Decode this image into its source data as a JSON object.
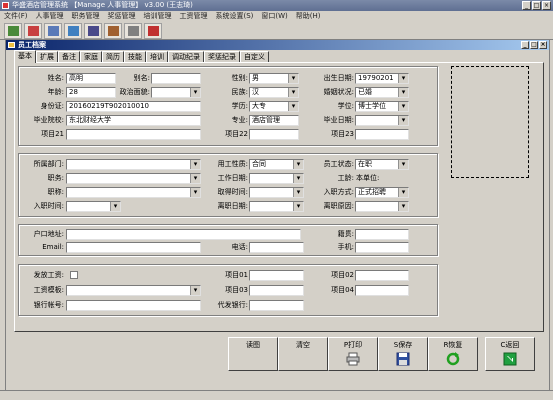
{
  "app": {
    "title": "华盛酒店管理系统 【Manage 人事管理】 v3.00 (王志琦)",
    "window_buttons": [
      "_",
      "□",
      "×"
    ]
  },
  "menu": [
    "文件(F)",
    "人事管理",
    "职务管理",
    "奖惩管理",
    "培训管理",
    "工资管理",
    "系统设置(S)",
    "窗口(W)",
    "帮助(H)"
  ],
  "child": {
    "title": "员工档案",
    "buttons": [
      "_",
      "□",
      "×"
    ]
  },
  "tabs": [
    "基本",
    "扩展",
    "备注",
    "家庭",
    "简历",
    "技能",
    "培训",
    "调动纪录",
    "奖惩纪录",
    "自定义"
  ],
  "basic": {
    "name_label": "姓名:",
    "name_value": "高明",
    "alias_label": "别名:",
    "alias_value": "",
    "gender_label": "性别:",
    "gender_value": "男",
    "birth_label": "出生日期:",
    "birth_value": "19790201",
    "age_label": "年龄:",
    "age_value": "28",
    "political_label": "政治面貌:",
    "political_value": "",
    "ethnic_label": "民族:",
    "ethnic_value": "汉",
    "marital_label": "婚姻状况:",
    "marital_value": "已婚",
    "id_label": "身份证:",
    "id_value": "20160219T902010010",
    "education_label": "学历:",
    "education_value": "大专",
    "degree_label": "学位:",
    "degree_value": "博士学位",
    "school_label": "毕业院校:",
    "school_value": "东北财经大学",
    "major_label": "专业:",
    "major_value": "酒店管理",
    "graddate_label": "毕业日期:",
    "graddate_value": "",
    "item21_label": "项目21",
    "item21_value": "",
    "item22_label": "项目22",
    "item22_value": "",
    "item23_label": "项目23",
    "item23_value": ""
  },
  "job": {
    "dept_label": "所属部门:",
    "dept_value": "",
    "emptype_label": "用工性质:",
    "emptype_value": "合同",
    "status_label": "员工状态:",
    "status_value": "在职",
    "position_label": "职务:",
    "position_value": "",
    "workdate_label": "工作日期:",
    "workdate_value": "",
    "seniority_label": "工龄:",
    "seniority_value": "本单位:",
    "title_label": "职称:",
    "title_value": "",
    "titledate_label": "取得时间:",
    "titledate_value": "",
    "entrymode_label": "入职方式:",
    "entrymode_value": "正式招聘",
    "entrydate_label": "入职时间:",
    "entrydate_value": "",
    "leavedate_label": "离职日期:",
    "leavedate_value": "",
    "leavereason_label": "离职原因:",
    "leavereason_value": ""
  },
  "contact": {
    "hukou_label": "户口地址:",
    "hukou_value": "",
    "native_label": "籍贯:",
    "native_value": "",
    "email_label": "Email:",
    "email_value": "",
    "phone_label": "电话:",
    "phone_value": "",
    "mobile_label": "手机:",
    "mobile_value": ""
  },
  "salary": {
    "paysalary_label": "发放工资:",
    "template_label": "工资模板:",
    "template_value": "",
    "bankacct_label": "银行帐号:",
    "bankacct_value": "",
    "item01_label": "项目01",
    "item01_value": "",
    "item02_label": "项目02",
    "item02_value": "",
    "item03_label": "项目03",
    "item03_value": "",
    "item04_label": "项目04",
    "item04_value": "",
    "agentbank_label": "代发银行:",
    "agentbank_value": ""
  },
  "actions": {
    "read_label": "读图",
    "clear_label": "清空",
    "print_label": "P打印",
    "save_label": "S保存",
    "restore_label": "R恢复",
    "back_label": "C返回"
  }
}
